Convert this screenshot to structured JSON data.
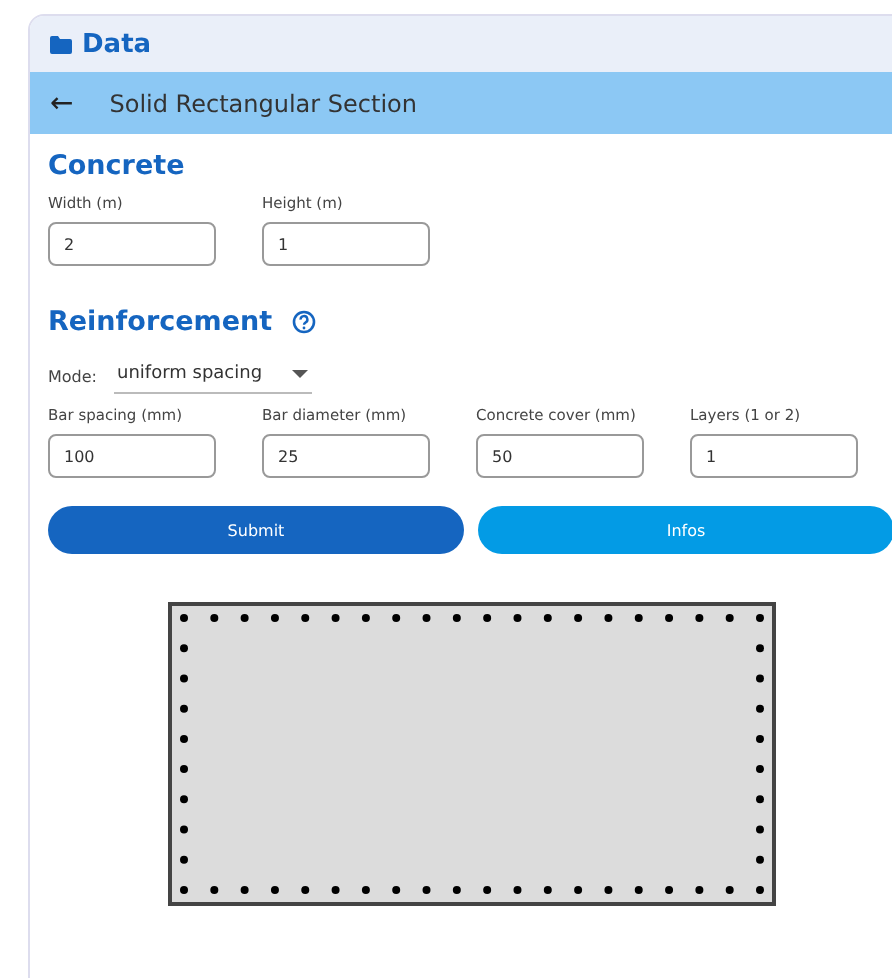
{
  "panel": {
    "title": "Data"
  },
  "toolbar": {
    "back": "←",
    "title": "Solid Rectangular Section"
  },
  "concrete": {
    "heading": "Concrete",
    "fields": [
      {
        "label": "Width (m)",
        "value": "2"
      },
      {
        "label": "Height (m)",
        "value": "1"
      }
    ]
  },
  "reinforcement": {
    "heading": "Reinforcement",
    "mode_label": "Mode:",
    "mode_value": "uniform spacing",
    "fields": [
      {
        "label": "Bar spacing (mm)",
        "value": "100"
      },
      {
        "label": "Bar diameter (mm)",
        "value": "25"
      },
      {
        "label": "Concrete cover (mm)",
        "value": "50"
      },
      {
        "label": "Layers (1 or 2)",
        "value": "1"
      }
    ]
  },
  "buttons": [
    {
      "label": "Submit",
      "kind": "primary"
    },
    {
      "label": "Infos",
      "kind": "secondary"
    }
  ]
}
